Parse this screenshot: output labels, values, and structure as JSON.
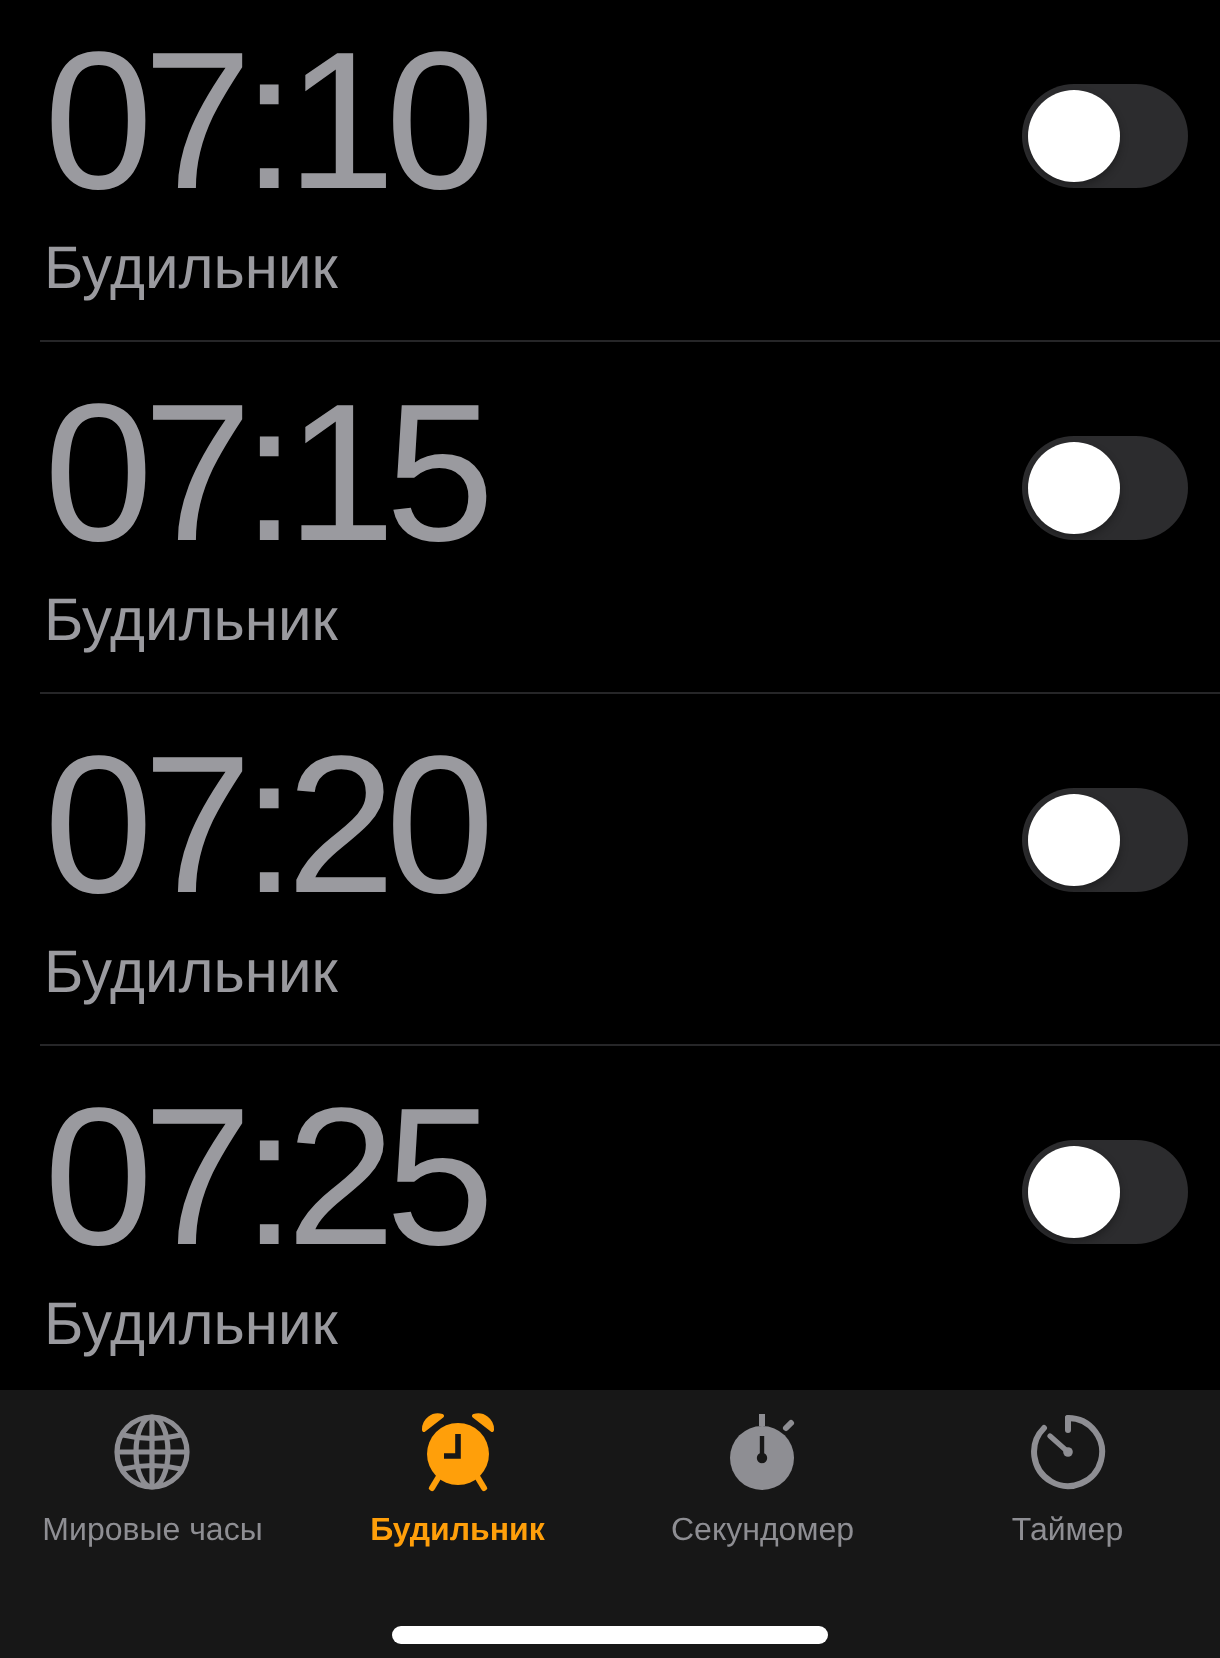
{
  "alarms": [
    {
      "time": "07:10",
      "label": "Будильник",
      "on": false
    },
    {
      "time": "07:15",
      "label": "Будильник",
      "on": false
    },
    {
      "time": "07:20",
      "label": "Будильник",
      "on": false
    },
    {
      "time": "07:25",
      "label": "Будильник",
      "on": false
    }
  ],
  "tab_bar": {
    "tabs": [
      {
        "kind": "globe",
        "label": "Мировые часы",
        "selected": false
      },
      {
        "kind": "alarm",
        "label": "Будильник",
        "selected": true
      },
      {
        "kind": "stopwatch",
        "label": "Секундомер",
        "selected": false
      },
      {
        "kind": "timer",
        "label": "Таймер",
        "selected": false
      }
    ]
  }
}
